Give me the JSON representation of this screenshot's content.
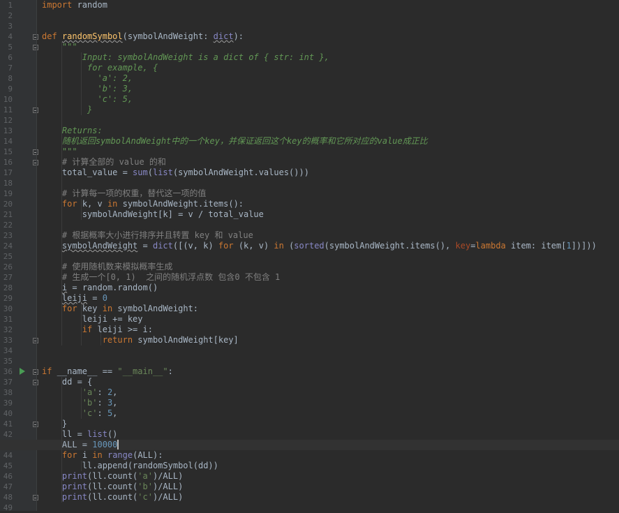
{
  "editor": {
    "language": "Python",
    "theme_colors": {
      "background": "#2b2b2b",
      "gutter": "#313335",
      "keyword": "#cc7832",
      "function": "#ffc66d",
      "number": "#6897bb",
      "string": "#6a8759",
      "docstring": "#629755",
      "comment": "#808080",
      "builtin": "#8888c6"
    },
    "current_line": 43,
    "lines": [
      [
        [
          "kw",
          "import"
        ],
        [
          "pln",
          " random"
        ]
      ],
      [],
      [],
      [
        [
          "kw",
          "def"
        ],
        [
          "pln",
          " "
        ],
        [
          "fn",
          "randomSymbol",
          "wavy"
        ],
        [
          "pln",
          "(symbolAndWeight: "
        ],
        [
          "bi",
          "dict",
          "wavy"
        ],
        [
          "pln",
          "):"
        ]
      ],
      [
        [
          "doc",
          "    \"\"\""
        ]
      ],
      [
        [
          "doc",
          "        Input: symbolAndWeight is a dict of { str: int },"
        ]
      ],
      [
        [
          "doc",
          "         for example, {"
        ]
      ],
      [
        [
          "doc",
          "           'a': 2,"
        ]
      ],
      [
        [
          "doc",
          "           'b': 3,"
        ]
      ],
      [
        [
          "doc",
          "           'c': 5,"
        ]
      ],
      [
        [
          "doc",
          "         }"
        ]
      ],
      [],
      [
        [
          "doc",
          "    Returns:"
        ]
      ],
      [
        [
          "doc",
          "    随机返回symbolAndWeight中的一个key，并保证返回这个key的概率和它所对应的value成正比"
        ]
      ],
      [
        [
          "doc",
          "    \"\"\""
        ]
      ],
      [
        [
          "cmt",
          "    # 计算全部的 value 的和"
        ]
      ],
      [
        [
          "pln",
          "    total_value = "
        ],
        [
          "bi",
          "sum"
        ],
        [
          "pln",
          "("
        ],
        [
          "bi",
          "list"
        ],
        [
          "pln",
          "(symbolAndWeight.values()))"
        ]
      ],
      [],
      [
        [
          "cmt",
          "    # 计算每一项的权重，替代这一项的值"
        ]
      ],
      [
        [
          "pln",
          "    "
        ],
        [
          "kw",
          "for"
        ],
        [
          "pln",
          " k, v "
        ],
        [
          "kw",
          "in"
        ],
        [
          "pln",
          " symbolAndWeight.items():"
        ]
      ],
      [
        [
          "pln",
          "        symbolAndWeight[k] = v / total_value"
        ]
      ],
      [],
      [
        [
          "cmt",
          "    # 根据概率大小进行排序并且转置 key 和 value"
        ]
      ],
      [
        [
          "pln",
          "    "
        ],
        [
          "pln",
          "symbolAndWeight",
          "wavy"
        ],
        [
          "pln",
          " = "
        ],
        [
          "bi",
          "dict"
        ],
        [
          "pln",
          "([(v, k) "
        ],
        [
          "kw",
          "for"
        ],
        [
          "pln",
          " (k, v) "
        ],
        [
          "kw",
          "in"
        ],
        [
          "pln",
          " ("
        ],
        [
          "bi",
          "sorted"
        ],
        [
          "pln",
          "(symbolAndWeight.items(), "
        ],
        [
          "prm",
          "key"
        ],
        [
          "pln",
          "="
        ],
        [
          "kw",
          "lambda"
        ],
        [
          "pln",
          " item: item["
        ],
        [
          "num",
          "1"
        ],
        [
          "pln",
          "])]))"
        ]
      ],
      [],
      [
        [
          "cmt",
          "    # 使用随机数来模拟概率生成"
        ]
      ],
      [
        [
          "cmt",
          "    # 生成一个[0, 1)  之间的随机浮点数 包含0 不包含 1"
        ]
      ],
      [
        [
          "pln",
          "    "
        ],
        [
          "pln",
          "i",
          "wavy"
        ],
        [
          "pln",
          " = random.random()"
        ]
      ],
      [
        [
          "pln",
          "    "
        ],
        [
          "pln",
          "leiji",
          "wavy"
        ],
        [
          "pln",
          " = "
        ],
        [
          "num",
          "0"
        ]
      ],
      [
        [
          "pln",
          "    "
        ],
        [
          "kw",
          "for"
        ],
        [
          "pln",
          " key "
        ],
        [
          "kw",
          "in"
        ],
        [
          "pln",
          " symbolAndWeight:"
        ]
      ],
      [
        [
          "pln",
          "        leiji += key"
        ]
      ],
      [
        [
          "pln",
          "        "
        ],
        [
          "kw",
          "if"
        ],
        [
          "pln",
          " leiji >= i:"
        ]
      ],
      [
        [
          "pln",
          "            "
        ],
        [
          "kw",
          "return"
        ],
        [
          "pln",
          " symbolAndWeight[key]"
        ]
      ],
      [],
      [],
      [
        [
          "kw",
          "if"
        ],
        [
          "pln",
          " __name__ == "
        ],
        [
          "str",
          "\"__main__\""
        ],
        [
          "pln",
          ":"
        ]
      ],
      [
        [
          "pln",
          "    dd = {"
        ]
      ],
      [
        [
          "pln",
          "        "
        ],
        [
          "str",
          "'a'"
        ],
        [
          "pln",
          ": "
        ],
        [
          "num",
          "2"
        ],
        [
          "pln",
          ","
        ]
      ],
      [
        [
          "pln",
          "        "
        ],
        [
          "str",
          "'b'"
        ],
        [
          "pln",
          ": "
        ],
        [
          "num",
          "3"
        ],
        [
          "pln",
          ","
        ]
      ],
      [
        [
          "pln",
          "        "
        ],
        [
          "str",
          "'c'"
        ],
        [
          "pln",
          ": "
        ],
        [
          "num",
          "5"
        ],
        [
          "pln",
          ","
        ]
      ],
      [
        [
          "pln",
          "    }"
        ]
      ],
      [
        [
          "pln",
          "    ll = "
        ],
        [
          "bi",
          "list"
        ],
        [
          "pln",
          "()"
        ]
      ],
      [
        [
          "pln",
          "    ALL = "
        ],
        [
          "num",
          "10000"
        ]
      ],
      [
        [
          "pln",
          "    "
        ],
        [
          "kw",
          "for"
        ],
        [
          "pln",
          " i "
        ],
        [
          "kw",
          "in"
        ],
        [
          "pln",
          " "
        ],
        [
          "bi",
          "range"
        ],
        [
          "pln",
          "(ALL):"
        ]
      ],
      [
        [
          "pln",
          "        ll.append(randomSymbol(dd))"
        ]
      ],
      [
        [
          "pln",
          "    "
        ],
        [
          "bi",
          "print"
        ],
        [
          "pln",
          "(ll.count("
        ],
        [
          "str",
          "'a'"
        ],
        [
          "pln",
          ")/ALL)"
        ]
      ],
      [
        [
          "pln",
          "    "
        ],
        [
          "bi",
          "print"
        ],
        [
          "pln",
          "(ll.count("
        ],
        [
          "str",
          "'b'"
        ],
        [
          "pln",
          ")/ALL)"
        ]
      ],
      [
        [
          "pln",
          "    "
        ],
        [
          "bi",
          "print"
        ],
        [
          "pln",
          "(ll.count("
        ],
        [
          "str",
          "'c'"
        ],
        [
          "pln",
          ")/ALL)"
        ]
      ],
      []
    ]
  }
}
